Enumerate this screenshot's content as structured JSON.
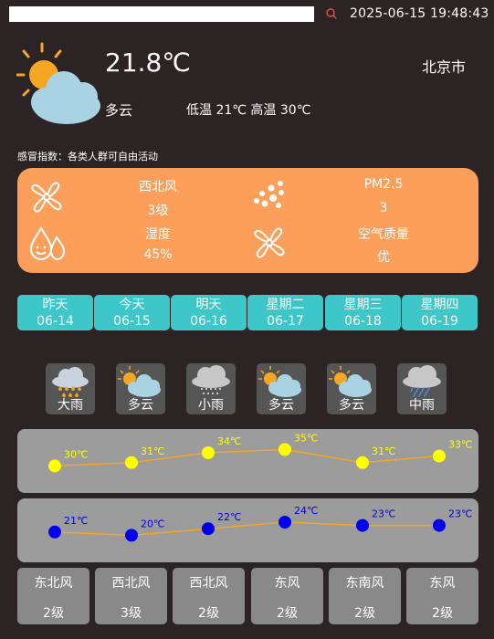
{
  "search": {
    "value": "",
    "placeholder": ""
  },
  "header": {
    "datetime": "2025-06-15 19:48:43"
  },
  "current": {
    "temperature": "21.8℃",
    "city": "北京市",
    "condition": "多云",
    "temp_range": "低温 21℃ 高温 30℃",
    "cold_index": "感冒指数：各类人群可自由活动",
    "wind_dir": "西北风",
    "wind_level": "3级",
    "pm25_label": "PM2.5",
    "pm25_value": "3",
    "humidity_label": "湿度",
    "humidity_value": "45%",
    "aqi_label": "空气质量",
    "aqi_value": "优"
  },
  "days": [
    {
      "name": "昨天",
      "date": "06-14"
    },
    {
      "name": "今天",
      "date": "06-15"
    },
    {
      "name": "明天",
      "date": "06-16"
    },
    {
      "name": "星期二",
      "date": "06-17"
    },
    {
      "name": "星期三",
      "date": "06-18"
    },
    {
      "name": "星期四",
      "date": "06-19"
    }
  ],
  "forecast": [
    {
      "label": "大雨",
      "icon": "heavy-rain-icon"
    },
    {
      "label": "多云",
      "icon": "partly-cloudy-icon"
    },
    {
      "label": "小雨",
      "icon": "light-rain-icon"
    },
    {
      "label": "多云",
      "icon": "partly-cloudy-icon"
    },
    {
      "label": "多云",
      "icon": "partly-cloudy-icon"
    },
    {
      "label": "中雨",
      "icon": "moderate-rain-icon"
    }
  ],
  "chart_data": [
    {
      "type": "line",
      "name": "high-temperature",
      "categories": [
        "06-14",
        "06-15",
        "06-16",
        "06-17",
        "06-18",
        "06-19"
      ],
      "values": [
        30,
        31,
        34,
        35,
        31,
        33
      ],
      "labels": [
        "30℃",
        "31℃",
        "34℃",
        "35℃",
        "31℃",
        "33℃"
      ],
      "point_color": "#ffff00",
      "line_color": "#f5a623",
      "label_color": "#ffff00",
      "ylim": [
        24,
        39
      ]
    },
    {
      "type": "line",
      "name": "low-temperature",
      "categories": [
        "06-14",
        "06-15",
        "06-16",
        "06-17",
        "06-18",
        "06-19"
      ],
      "values": [
        21,
        20,
        22,
        24,
        23,
        23
      ],
      "labels": [
        "21℃",
        "20℃",
        "22℃",
        "24℃",
        "23℃",
        "23℃"
      ],
      "point_color": "#0000ee",
      "line_color": "#f5a623",
      "label_color": "#0000ee",
      "ylim": [
        14,
        29
      ]
    }
  ],
  "wind": [
    {
      "dir": "东北风",
      "level": "2级"
    },
    {
      "dir": "西北风",
      "level": "3级"
    },
    {
      "dir": "西北风",
      "level": "2级"
    },
    {
      "dir": "东风",
      "level": "2级"
    },
    {
      "dir": "东南风",
      "level": "2级"
    },
    {
      "dir": "东风",
      "level": "2级"
    }
  ],
  "colors": {
    "background": "#2b2324",
    "info_card": "#fc9f5a",
    "day_tab": "#3ec7c9",
    "chart_bg": "#9c9c9c",
    "wind_tile": "#898989"
  }
}
